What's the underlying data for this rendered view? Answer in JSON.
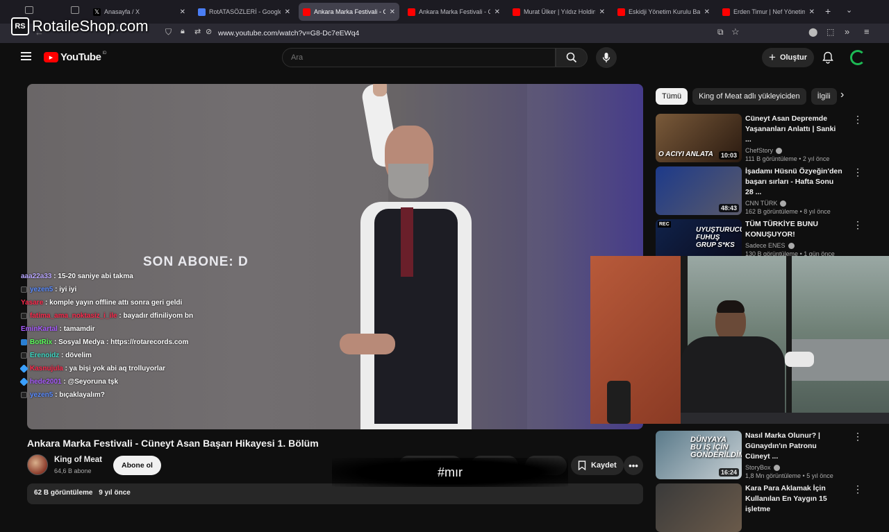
{
  "watermark": {
    "logo": "RS",
    "text": "RotaileShop.com"
  },
  "browser": {
    "tabs": [
      {
        "label": "Anasayfa / X",
        "favicon": "x-logo-icon",
        "active": false
      },
      {
        "label": "RotATASÖZLERİ - Google D",
        "favicon": "google-docs-icon",
        "active": false
      },
      {
        "label": "Ankara Marka Festivali - Cün",
        "favicon": "youtube-icon",
        "active": true
      },
      {
        "label": "Ankara Marka Festivali - Cün",
        "favicon": "youtube-icon",
        "active": false
      },
      {
        "label": "Murat Ülker | Yıldız Holding",
        "favicon": "youtube-icon",
        "active": false
      },
      {
        "label": "Eskidji Yönetim Kurulu Başk",
        "favicon": "youtube-icon",
        "active": false
      },
      {
        "label": "Erden Timur | Nef Yönetim K",
        "favicon": "youtube-icon",
        "active": false
      }
    ],
    "url": "www.youtube.com/watch?v=G8-Dc7eEWq4",
    "colors": {
      "tab_bar": "#1c1b22",
      "active_tab": "#42414d",
      "url_bar": "#2b2a33"
    }
  },
  "youtube": {
    "logo_text": "YouTube",
    "region": "ID",
    "search_placeholder": "Ara",
    "create_label": "Oluştur"
  },
  "video": {
    "overlay_text": "SON ABONE: D",
    "title": "Ankara Marka Festivali - Cüneyt Asan Başarı Hikayesi 1. Bölüm",
    "channel": "King of Meat",
    "subscribers": "64,6 B abone",
    "subscribe_label": "Abone ol",
    "save_label": "Kaydet",
    "views": "62 B görüntüleme",
    "age": "9 yıl önce",
    "hashtag": "#mır"
  },
  "chat": [
    {
      "user": "aaa22a33",
      "color": "#b9a7ff",
      "msg": "15-20 saniye abi takma",
      "badge": ""
    },
    {
      "user": "yezen5",
      "color": "#5b8cff",
      "msg": "iyi iyi",
      "badge": "dark"
    },
    {
      "user": "Yasare",
      "color": "#ff2a4d",
      "msg": "komple yayın offline attı sonra geri geldi",
      "badge": ""
    },
    {
      "user": "fatima_ama_noktasiz_i_ile",
      "color": "#ff2a4d",
      "msg": "bayadır dfiniliyom bn",
      "badge": "dark"
    },
    {
      "user": "EminKartal",
      "color": "#a95bff",
      "msg": "tamamdir",
      "badge": ""
    },
    {
      "user": "BotRix",
      "color": "#5bff5b",
      "msg": "Sosyal Medya : https://rotarecords.com",
      "badge": "bot"
    },
    {
      "user": "Erenoidz",
      "color": "#3cd8c3",
      "msg": "dövelim",
      "badge": "dark"
    },
    {
      "user": "Kasnujula",
      "color": "#ff2a4d",
      "msg": "ya bişi yok abi aq trolluyorlar",
      "badge": "cube"
    },
    {
      "user": "hede2001",
      "color": "#a95bff",
      "msg": "@Seyoruna tşk",
      "badge": "cube"
    },
    {
      "user": "yezen5",
      "color": "#5b8cff",
      "msg": "bıçaklayalım?",
      "badge": "dark"
    }
  ],
  "filters": [
    "Tümü",
    "King of Meat adlı yükleyiciden",
    "İlgili"
  ],
  "recommendations": [
    {
      "title": "Cüneyt Asan Depremde Yaşananları Anlattı | Sanki ...",
      "channel": "ChefStory",
      "views": "111 B görüntüleme",
      "age": "2 yıl önce",
      "duration": "10:03",
      "thumb_text": "O ACIYI ANLATA",
      "thumb_colors": [
        "#7a5a3a",
        "#2a1a10"
      ]
    },
    {
      "title": "İşadamı Hüsnü Özyeğin'den başarı sırları - Hafta Sonu 28 ...",
      "channel": "CNN TÜRK",
      "views": "162 B görüntüleme",
      "age": "8 yıl önce",
      "duration": "48:43",
      "thumb_text": "",
      "thumb_colors": [
        "#1d3a8a",
        "#5a5a6a"
      ]
    },
    {
      "title": "TÜM TÜRKİYE BUNU KONUŞUYOR!",
      "channel": "Sadece ENES",
      "views": "130 B görüntüleme",
      "age": "1 gün önce",
      "duration": "",
      "thumb_text": "UYUŞTURUCU FUHUŞ GRUP S*KS",
      "thumb_colors": [
        "#10224a",
        "#0a0a1a"
      ]
    },
    {
      "title": "Nasıl Marka Olunur? | Günaydın'ın Patronu Cüneyt ...",
      "channel": "StoryBox",
      "views": "1,8 Mn görüntüleme",
      "age": "5 yıl önce",
      "duration": "16:24",
      "thumb_text": "DÜNYAYA BU İŞ İÇİN GÖNDERİLDİM",
      "thumb_colors": [
        "#5a7a8a",
        "#c8d0d4"
      ]
    },
    {
      "title": "Kara Para Aklamak İçin Kullanılan En Yaygın 15 işletme",
      "channel": "",
      "views": "",
      "age": "",
      "duration": "",
      "thumb_text": "",
      "thumb_colors": [
        "#3a3a3a",
        "#6a5a4a"
      ]
    }
  ],
  "rec_badge": "REC",
  "accent": "#ff0000"
}
